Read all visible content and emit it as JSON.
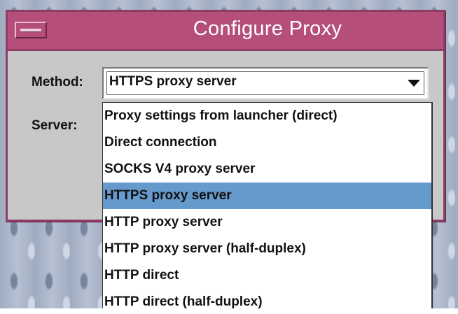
{
  "window": {
    "title": "Configure Proxy"
  },
  "form": {
    "method_label": "Method:",
    "server_label": "Server:",
    "method_value": "HTTPS proxy server"
  },
  "dropdown": {
    "selected_index": 3,
    "options": [
      "Proxy settings from launcher (direct)",
      "Direct connection",
      "SOCKS V4 proxy server",
      "HTTPS proxy server",
      "HTTP proxy server",
      "HTTP proxy server (half-duplex)",
      "HTTP direct",
      "HTTP direct (half-duplex)"
    ]
  },
  "colors": {
    "titlebar": "#b54e7a",
    "selection": "#6699cc",
    "dialog_bg": "#c8c8c8"
  },
  "icons": {
    "window_menu": "window-menu-icon",
    "dropdown_arrow": "dropdown-arrow-icon"
  }
}
